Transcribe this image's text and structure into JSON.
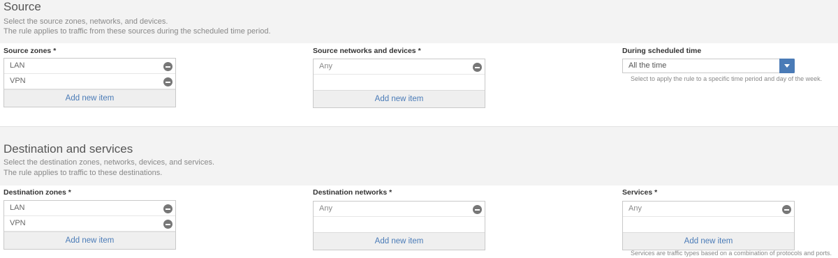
{
  "source": {
    "title": "Source",
    "desc_line1": "Select the source zones, networks, and devices.",
    "desc_line2": "The rule applies to traffic from these sources during the scheduled time period.",
    "zones": {
      "label": "Source zones",
      "required": "*",
      "items": [
        "LAN",
        "VPN"
      ],
      "add_label": "Add new item"
    },
    "networks": {
      "label": "Source networks and devices",
      "required": "*",
      "items": [
        "Any"
      ],
      "add_label": "Add new item"
    },
    "schedule": {
      "label": "During scheduled time",
      "value": "All the time",
      "hint": "Select to apply the rule to a specific time period and day of the week."
    }
  },
  "destination": {
    "title": "Destination and services",
    "desc_line1": "Select the destination zones, networks, devices, and services.",
    "desc_line2": "The rule applies to traffic to these destinations.",
    "zones": {
      "label": "Destination zones",
      "required": "*",
      "items": [
        "LAN",
        "VPN"
      ],
      "add_label": "Add new item"
    },
    "networks": {
      "label": "Destination networks",
      "required": "*",
      "items": [
        "Any"
      ],
      "add_label": "Add new item"
    },
    "services": {
      "label": "Services",
      "required": "*",
      "items": [
        "Any"
      ],
      "add_label": "Add new item",
      "hint": "Services are traffic types based on a combination of protocols and ports."
    }
  },
  "colors": {
    "accent": "#4a7bb7",
    "section_bg": "#f3f3f3"
  }
}
